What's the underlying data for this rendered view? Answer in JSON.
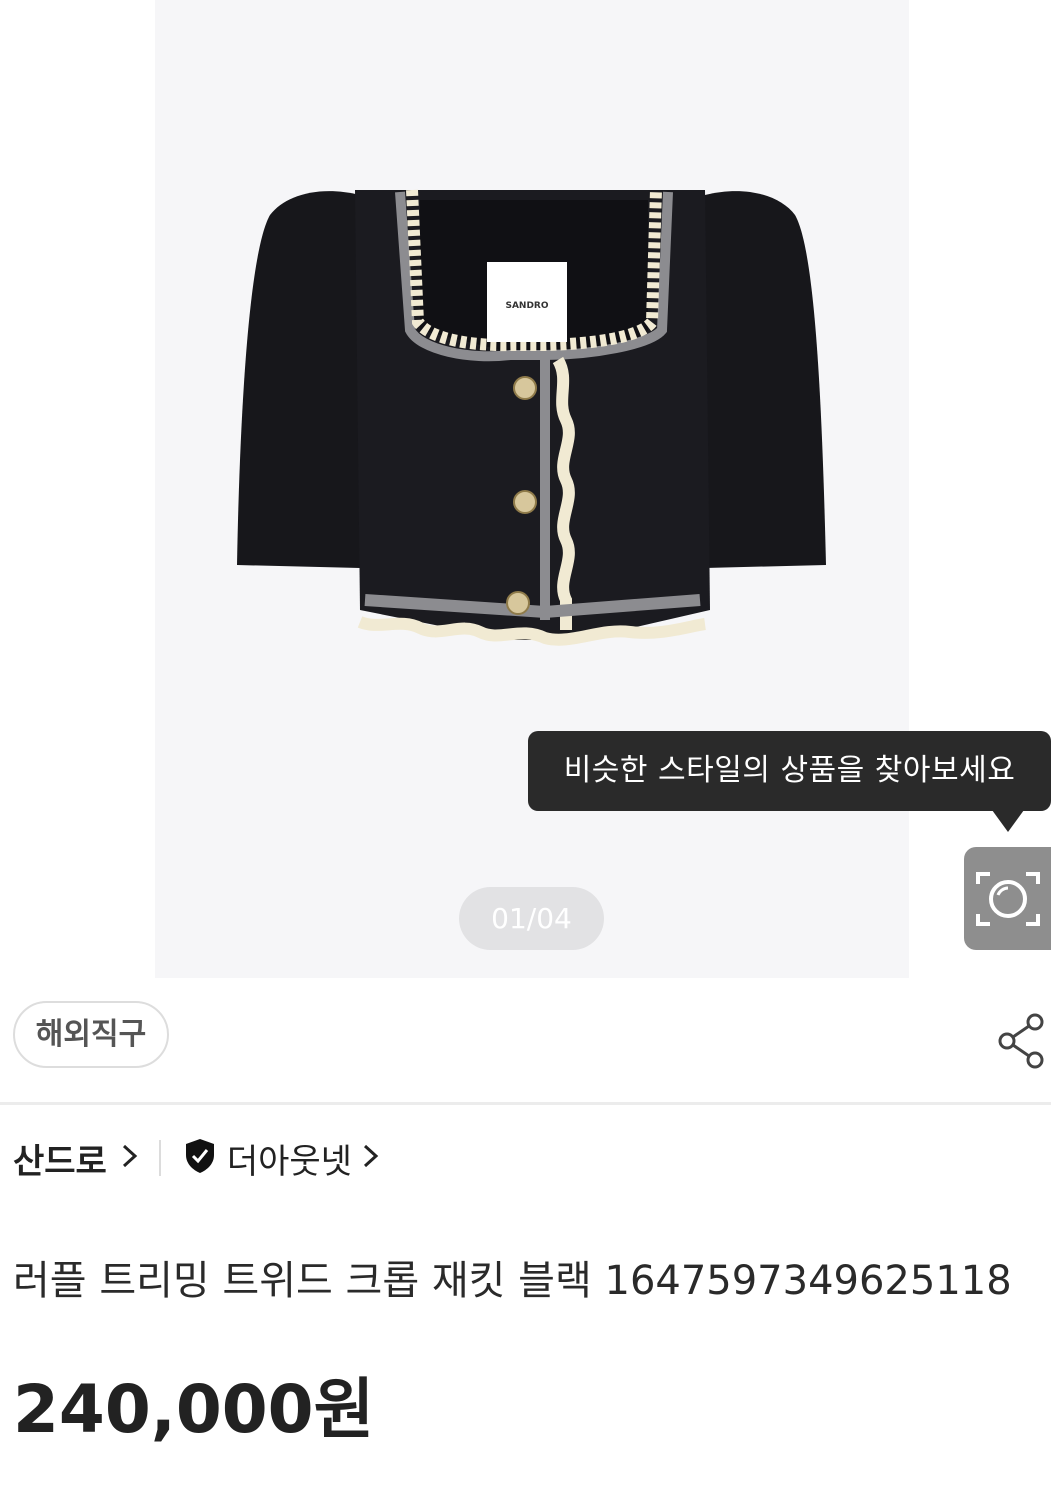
{
  "product_image": {
    "label_text": "SANDRO",
    "counter": "01/04"
  },
  "tooltip": {
    "text": "비슷한 스타일의 상품을 찾아보세요"
  },
  "icons": {
    "lens": "camera-lens-icon",
    "share": "share-icon",
    "verified": "verified-shield-icon",
    "chevron": "chevron-right-icon"
  },
  "tag": {
    "label": "해외직구"
  },
  "breadcrumb": {
    "brand": "산드로",
    "seller": "더아웃넷"
  },
  "product": {
    "title": "러플 트리밍 트위드 크롭 재킷 블랙 1647597349625118",
    "price": "240,000원"
  },
  "colors": {
    "jacket": "#17171b",
    "trim": "#f1ead3",
    "tooltip_bg": "#2a2a2a",
    "lens_button_bg": "#8e8e8e"
  }
}
